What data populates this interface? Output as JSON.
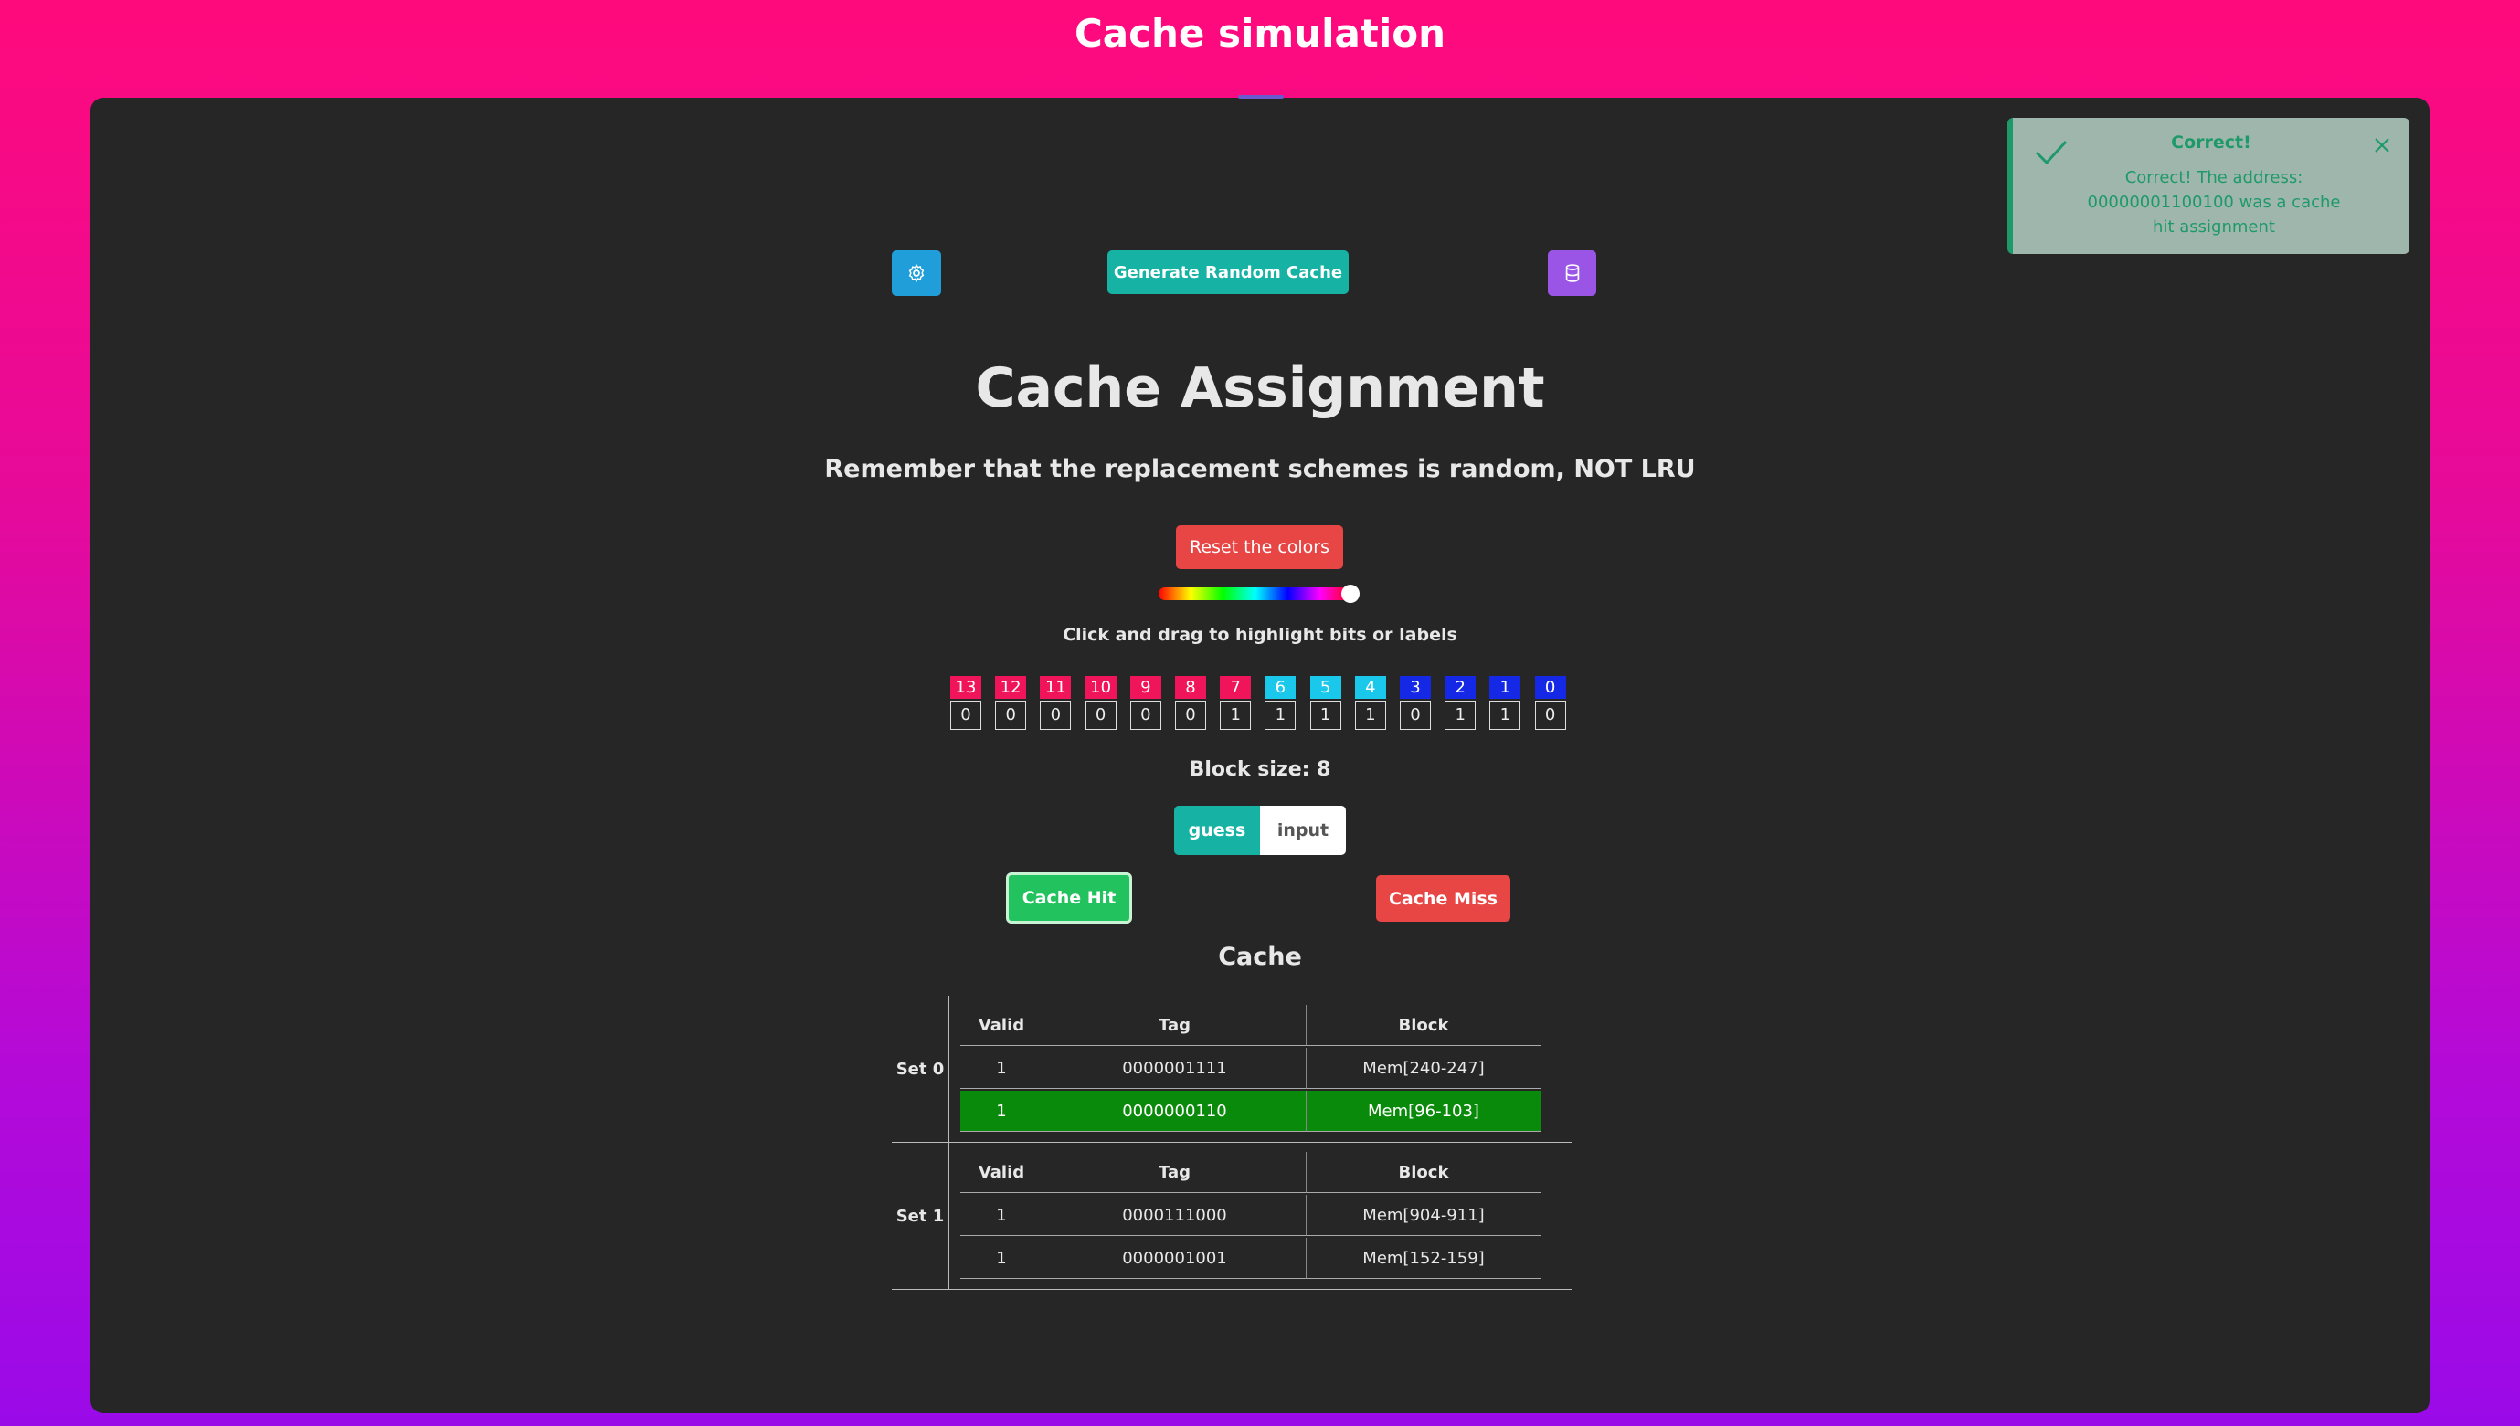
{
  "app": {
    "title": "Cache simulation"
  },
  "toast": {
    "title": "Correct!",
    "message": "Correct! The address: 00000001100100 was a cache hit assignment",
    "icon": "check-icon",
    "close_icon": "close-icon"
  },
  "toolbar": {
    "settings_icon": "gear-icon",
    "generate_label": "Generate Random Cache",
    "database_icon": "database-icon"
  },
  "heading": "Cache Assignment",
  "subheading": "Remember that the replacement schemes is random, NOT LRU",
  "reset_label": "Reset the colors",
  "hue_slider": {
    "value": 0.95
  },
  "hint": "Click and drag to highlight bits or labels",
  "bits": [
    {
      "label": "13",
      "value": "0",
      "color": "#f0145a"
    },
    {
      "label": "12",
      "value": "0",
      "color": "#f0145a"
    },
    {
      "label": "11",
      "value": "0",
      "color": "#f0145a"
    },
    {
      "label": "10",
      "value": "0",
      "color": "#f0145a"
    },
    {
      "label": "9",
      "value": "0",
      "color": "#f0145a"
    },
    {
      "label": "8",
      "value": "0",
      "color": "#f0145a"
    },
    {
      "label": "7",
      "value": "1",
      "color": "#f0145a"
    },
    {
      "label": "6",
      "value": "1",
      "color": "#19c8ea"
    },
    {
      "label": "5",
      "value": "1",
      "color": "#19c8ea"
    },
    {
      "label": "4",
      "value": "1",
      "color": "#19c8ea"
    },
    {
      "label": "3",
      "value": "0",
      "color": "#1428e6"
    },
    {
      "label": "2",
      "value": "1",
      "color": "#1428e6"
    },
    {
      "label": "1",
      "value": "1",
      "color": "#1428e6"
    },
    {
      "label": "0",
      "value": "0",
      "color": "#1428e6"
    }
  ],
  "block_size": "Block size: 8",
  "mode_toggle": {
    "options": [
      "guess",
      "input"
    ],
    "selected": "guess"
  },
  "answer": {
    "hit_label": "Cache Hit",
    "miss_label": "Cache Miss"
  },
  "cache": {
    "title": "Cache",
    "columns": [
      "Valid",
      "Tag",
      "Block"
    ],
    "sets": [
      {
        "label": "Set 0",
        "rows": [
          {
            "valid": "1",
            "tag": "0000001111",
            "block": "Mem[240-247]",
            "highlighted": false
          },
          {
            "valid": "1",
            "tag": "0000000110",
            "block": "Mem[96-103]",
            "highlighted": true
          }
        ]
      },
      {
        "label": "Set 1",
        "rows": [
          {
            "valid": "1",
            "tag": "0000111000",
            "block": "Mem[904-911]",
            "highlighted": false
          },
          {
            "valid": "1",
            "tag": "0000001001",
            "block": "Mem[152-159]",
            "highlighted": false
          }
        ]
      }
    ]
  }
}
